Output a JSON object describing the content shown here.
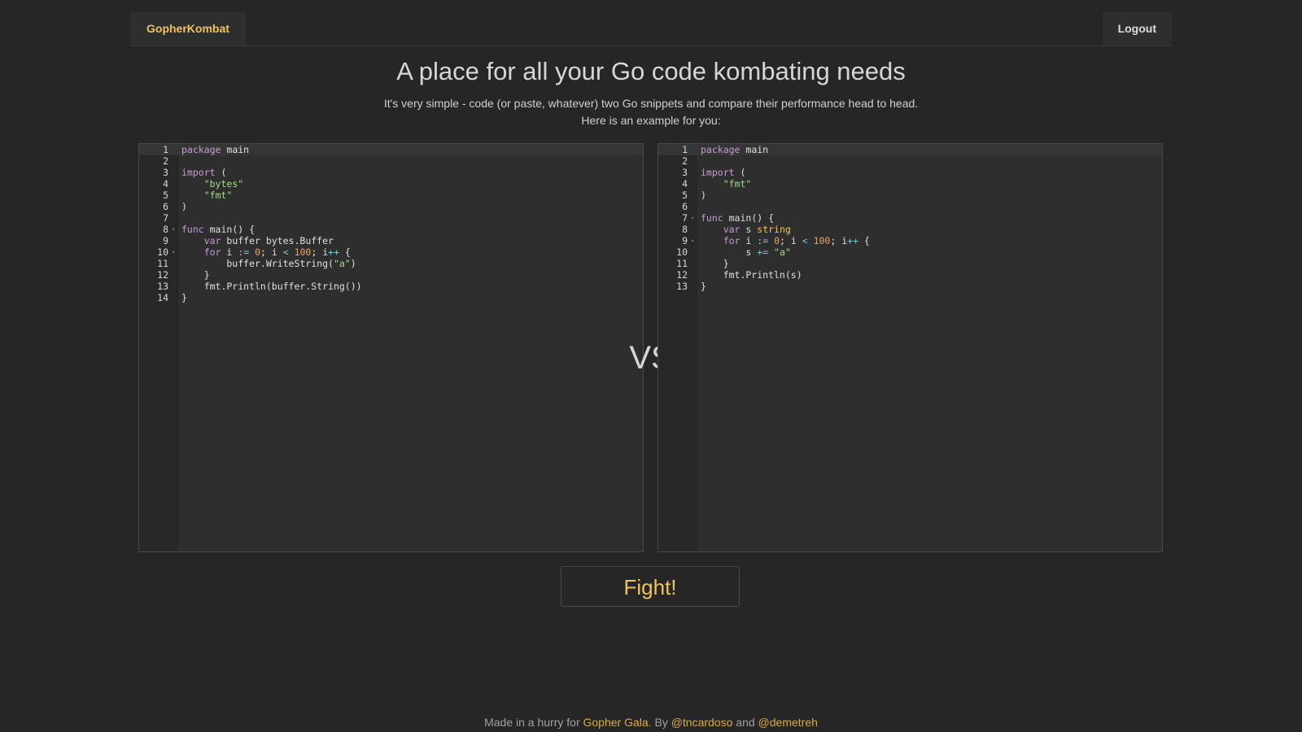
{
  "nav": {
    "brand": "GopherKombat",
    "logout": "Logout"
  },
  "hero": {
    "title": "A place for all your Go code kombating needs",
    "subtitle_line1": "It's very simple - code (or paste, whatever) two Go snippets and compare their performance head to head.",
    "subtitle_line2": "Here is an example for you:"
  },
  "editor_left": {
    "lines": [
      "package main",
      "",
      "import (",
      "    \"bytes\"",
      "    \"fmt\"",
      ")",
      "",
      "func main() {",
      "    var buffer bytes.Buffer",
      "    for i := 0; i < 100; i++ {",
      "        buffer.WriteString(\"a\")",
      "    }",
      "    fmt.Println(buffer.String())",
      "}"
    ],
    "fold_lines": [
      8,
      10
    ]
  },
  "editor_right": {
    "lines": [
      "package main",
      "",
      "import (",
      "    \"fmt\"",
      ")",
      "",
      "func main() {",
      "    var s string",
      "    for i := 0; i < 100; i++ {",
      "        s += \"a\"",
      "    }",
      "    fmt.Println(s)",
      "}"
    ],
    "fold_lines": [
      7,
      9
    ]
  },
  "vs_label": "VS",
  "fight_button": "Fight!",
  "footer": {
    "prefix": "Made in a hurry for ",
    "gala_link": "Gopher Gala",
    "by_text": ". By ",
    "author1": "@tncardoso",
    "and_text": " and ",
    "author2": "@demetreh"
  },
  "colors": {
    "background": "#262626",
    "accent": "#f0c35a",
    "link": "#d9a948"
  }
}
